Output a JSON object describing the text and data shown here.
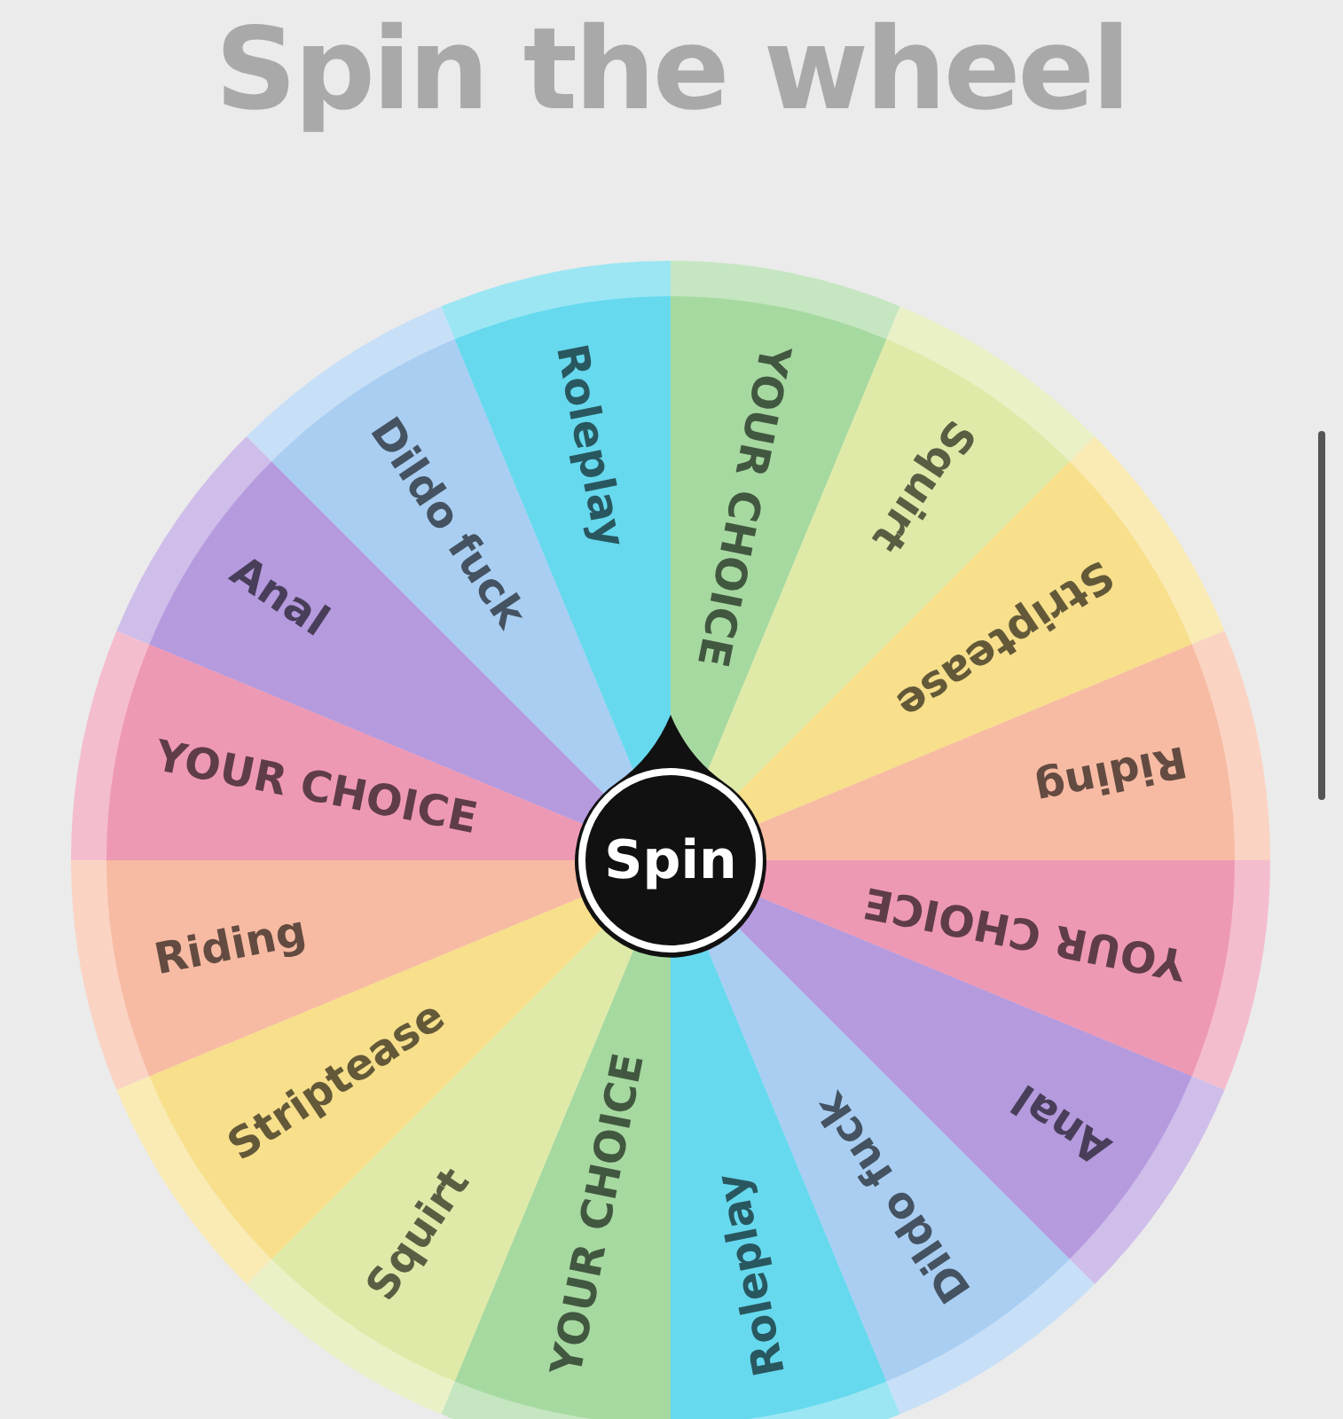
{
  "title": "Spin the wheel",
  "wheel": {
    "segments": [
      {
        "label": "YOUR CHOICE",
        "color": "#a6d9a0"
      },
      {
        "label": "Squirt",
        "color": "#dfeaa8"
      },
      {
        "label": "Striptease",
        "color": "#f7df8c"
      },
      {
        "label": "Riding",
        "color": "#f7bba3"
      },
      {
        "label": "YOUR CHOICE",
        "color": "#ee99b4"
      },
      {
        "label": "Anal",
        "color": "#b59ade"
      },
      {
        "label": "Dildo fuck",
        "color": "#a9cef2"
      },
      {
        "label": "Roleplay",
        "color": "#66d9ee"
      },
      {
        "label": "YOUR CHOICE",
        "color": "#a6d9a0"
      },
      {
        "label": "Squirt",
        "color": "#dfeaa8"
      },
      {
        "label": "Striptease",
        "color": "#f7df8c"
      },
      {
        "label": "Riding",
        "color": "#f7bba3"
      },
      {
        "label": "YOUR CHOICE",
        "color": "#ee99b4"
      },
      {
        "label": "Anal",
        "color": "#b59ade"
      },
      {
        "label": "Dildo fuck",
        "color": "#a9cef2"
      },
      {
        "label": "Roleplay",
        "color": "#66d9ee"
      }
    ],
    "button": "Spin"
  }
}
